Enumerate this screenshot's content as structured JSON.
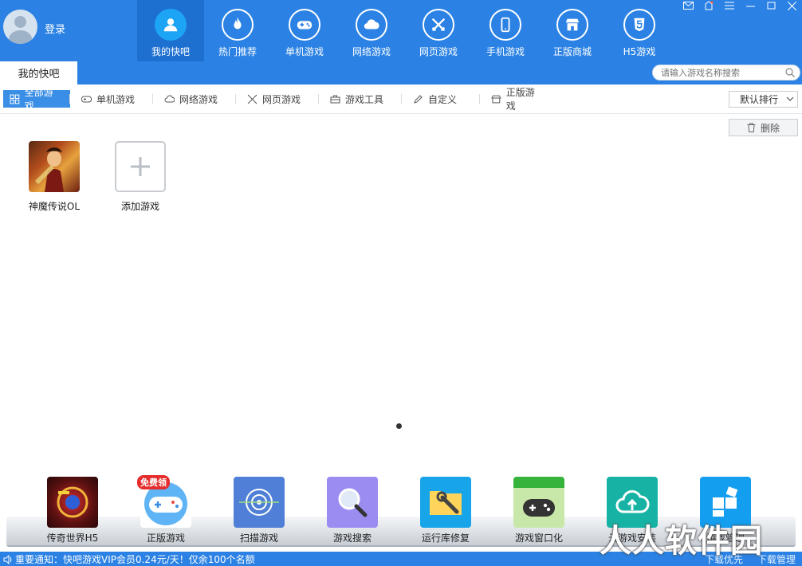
{
  "header": {
    "login_label": "登录",
    "nav": [
      {
        "label": "我的快吧",
        "icon": "user-icon",
        "active": true
      },
      {
        "label": "热门推荐",
        "icon": "fire-icon"
      },
      {
        "label": "单机游戏",
        "icon": "gamepad-icon"
      },
      {
        "label": "网络游戏",
        "icon": "cloud-icon"
      },
      {
        "label": "网页游戏",
        "icon": "crossed-swords-icon"
      },
      {
        "label": "手机游戏",
        "icon": "phone-icon"
      },
      {
        "label": "正版商城",
        "icon": "store-icon"
      },
      {
        "label": "H5游戏",
        "icon": "html5-icon"
      }
    ],
    "window_controls": [
      "mail-icon",
      "skin-icon",
      "menu-icon",
      "minimize-icon",
      "maximize-icon",
      "close-icon"
    ]
  },
  "tabbar": {
    "active_tab": "我的快吧",
    "search_placeholder": "请输入游戏名称搜索"
  },
  "filters": [
    {
      "label": "全部游戏",
      "icon": "grid-icon",
      "active": true
    },
    {
      "label": "单机游戏",
      "icon": "gamepad-icon"
    },
    {
      "label": "网络游戏",
      "icon": "cloud-icon"
    },
    {
      "label": "网页游戏",
      "icon": "crossed-swords-icon"
    },
    {
      "label": "游戏工具",
      "icon": "toolbox-icon"
    },
    {
      "label": "自定义",
      "icon": "pencil-icon"
    },
    {
      "label": "正版游戏",
      "icon": "store-icon"
    }
  ],
  "sort": {
    "selected": "默认排行"
  },
  "delete_label": "删除",
  "games": [
    {
      "name": "神魔传说OL"
    },
    {
      "name": "添加游戏"
    }
  ],
  "tools": [
    {
      "name": "传奇世界H5"
    },
    {
      "name": "正版游戏",
      "badge": "免费领"
    },
    {
      "name": "扫描游戏"
    },
    {
      "name": "游戏搜索"
    },
    {
      "name": "运行库修复"
    },
    {
      "name": "游戏窗口化"
    },
    {
      "name": "云游戏安装"
    },
    {
      "name": "游戏管理"
    }
  ],
  "status": {
    "notice": "重要通知：快吧游戏VIP会员0.24元/天！仅余100个名额",
    "download_priority": "下载优先",
    "download_manage": "下载管理"
  },
  "watermark": "人人软件园",
  "colors": {
    "primary": "#2b82e4",
    "active_nav": "#1d6fd0",
    "active_filter": "#3a8ee6"
  }
}
